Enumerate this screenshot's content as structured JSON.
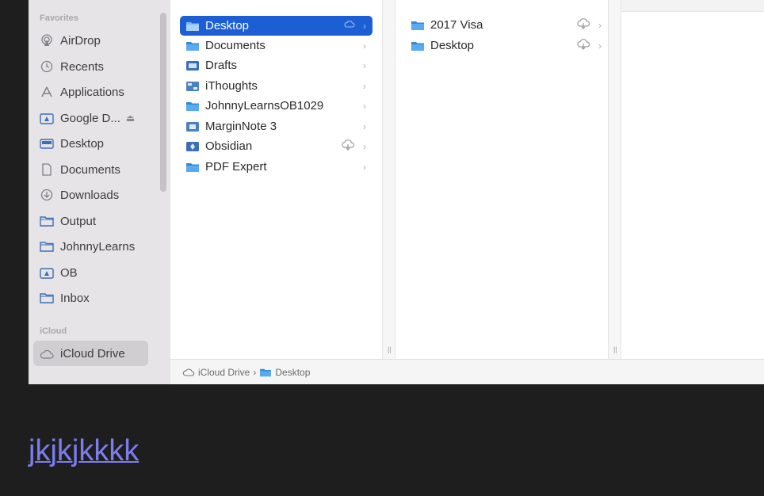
{
  "sidebar": {
    "favorites_heading": "Favorites",
    "icloud_heading": "iCloud",
    "items": [
      {
        "label": "AirDrop",
        "icon": "airdrop-icon"
      },
      {
        "label": "Recents",
        "icon": "clock-icon"
      },
      {
        "label": "Applications",
        "icon": "applications-icon"
      },
      {
        "label": "Google D...",
        "icon": "drive-folder-icon",
        "eject": "⏏"
      },
      {
        "label": "Desktop",
        "icon": "desktop-icon"
      },
      {
        "label": "Documents",
        "icon": "document-icon"
      },
      {
        "label": "Downloads",
        "icon": "download-icon"
      },
      {
        "label": "Output",
        "icon": "folder-icon"
      },
      {
        "label": "JohnnyLearns",
        "icon": "folder-icon"
      },
      {
        "label": "OB",
        "icon": "app-folder-icon"
      },
      {
        "label": "Inbox",
        "icon": "folder-icon"
      }
    ],
    "icloud_items": [
      {
        "label": "iCloud Drive",
        "icon": "cloud-icon",
        "selected": true
      }
    ]
  },
  "column1": {
    "items": [
      {
        "label": "Desktop",
        "selected": true,
        "cloud": true
      },
      {
        "label": "Documents"
      },
      {
        "label": "Drafts"
      },
      {
        "label": "iThoughts"
      },
      {
        "label": "JohnnyLearnsOB1029"
      },
      {
        "label": "MarginNote 3"
      },
      {
        "label": "Obsidian",
        "cloud": true
      },
      {
        "label": "PDF Expert"
      }
    ]
  },
  "column2": {
    "items": [
      {
        "label": "2017 Visa",
        "cloud": true
      },
      {
        "label": "Desktop",
        "cloud": true
      }
    ]
  },
  "pathbar": {
    "root": "iCloud Drive",
    "separator": "›",
    "current": "Desktop"
  },
  "caption": {
    "text": "jkjkjkkkk"
  },
  "colors": {
    "accent": "#1c5fd4",
    "folder": "#3aa0e6",
    "link": "#7d7df0"
  }
}
